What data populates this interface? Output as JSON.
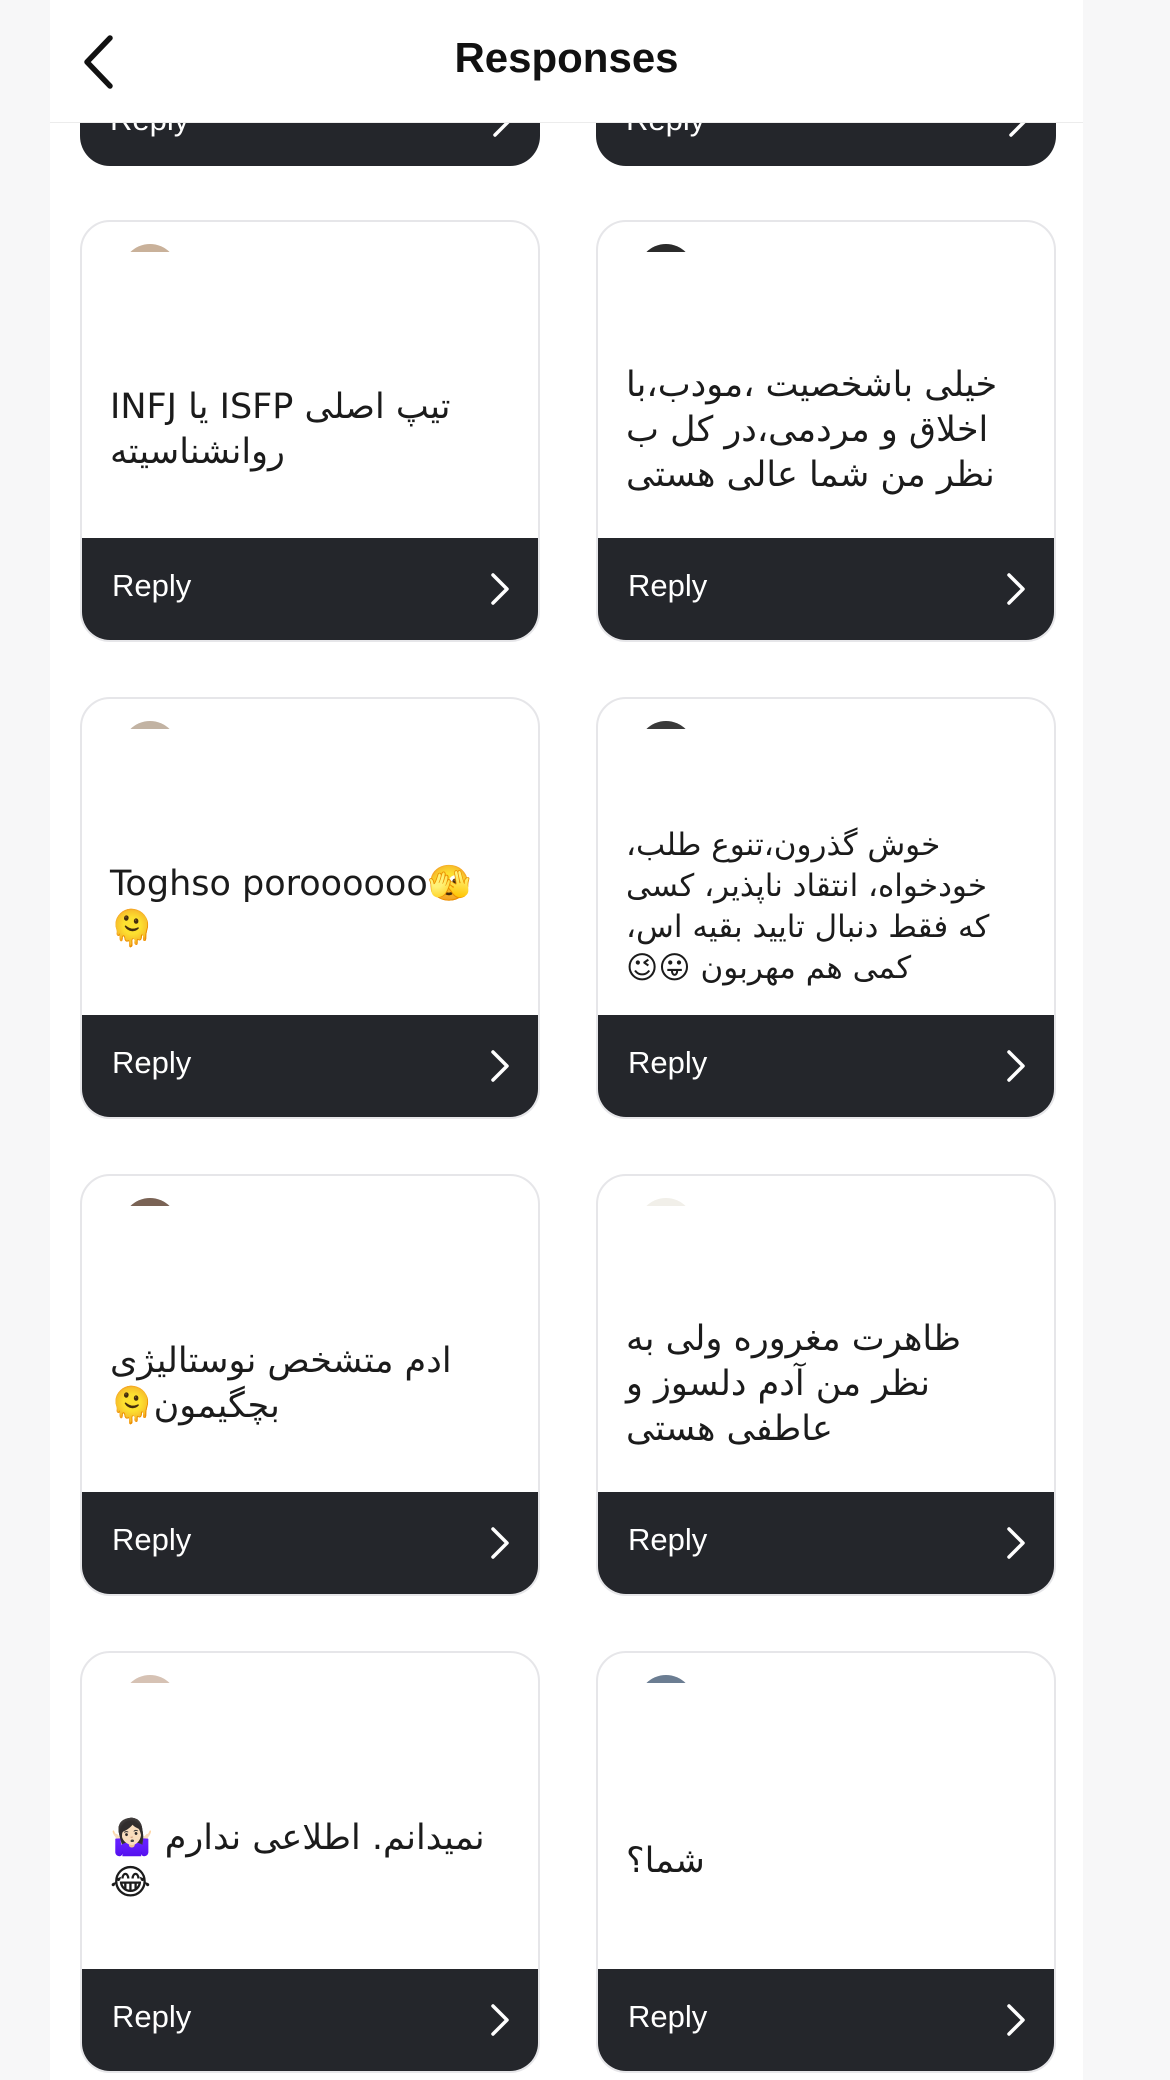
{
  "header": {
    "title": "Responses"
  },
  "reply_label": "Reply",
  "partial_top": [
    {
      "label": "Reply"
    },
    {
      "label": "Reply"
    }
  ],
  "cards": [
    {
      "text": "تیپ اصلی ISFP یا INFJ روانشناسیته",
      "reply": "Reply",
      "avatar_color": "#c9b19a"
    },
    {
      "text": "خیلی باشخصیت ،مودب،با اخلاق و مردمی،در کل ب نظر من شما عالی هستی",
      "reply": "Reply",
      "avatar_color": "#2b2b2b"
    },
    {
      "text": "Toghso poroooooo🫣🫠",
      "reply": "Reply",
      "avatar_color": "#c2b3a3"
    },
    {
      "text": "خوش گذرون،تنوع طلب، خودخواه، انتقاد ناپذیر، کسی که فقط دنبال تایید بقیه اس، کمی هم مهربون 😛😉",
      "reply": "Reply",
      "avatar_color": "#3a3a3a"
    },
    {
      "text": "ادم متشخص نوستالیژی بچگیمون🫠",
      "reply": "Reply",
      "avatar_color": "#7a6355"
    },
    {
      "text": "ظاهرت مغروره ولی به نظر من آدم دلسوز و عاطفی هستی",
      "reply": "Reply",
      "avatar_color": "#f1efe9"
    },
    {
      "text": "نمیدانم. اطلاعی ندارم 🤷🏻‍♀️😂",
      "reply": "Reply",
      "avatar_color": "#d6c2b4"
    },
    {
      "text": "شما؟",
      "reply": "Reply",
      "avatar_color": "#6b7d92"
    }
  ]
}
